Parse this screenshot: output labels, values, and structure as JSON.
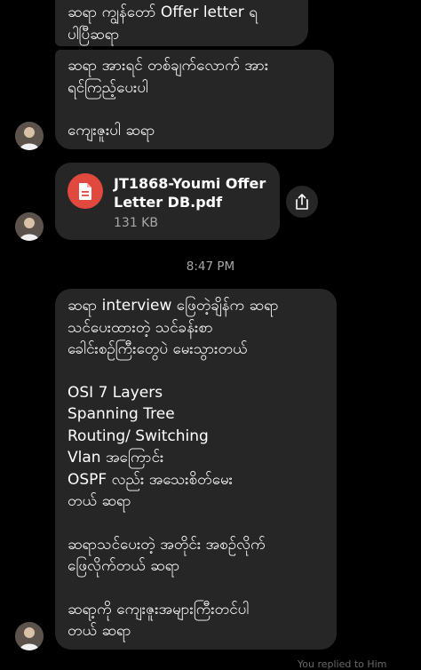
{
  "messages": {
    "bubble_1": {
      "line_1": "ဆရာ ကျွန်တော် Offer letter ရ",
      "line_2": "ပါပြီဆရာ"
    },
    "bubble_2": {
      "line_1": "ဆရာ အားရင် တစ်ချက်လောက် အား",
      "line_2": "ရင်ကြည့်ပေးပါ",
      "line_3": "ကျေးဇူးပါ ဆရာ"
    },
    "file": {
      "name": "JT1868-Youmi Offer Letter DB.pdf",
      "size": "131 KB",
      "icon": "document-icon",
      "icon_color": "#e2493e"
    },
    "timestamp": "8:47 PM",
    "bubble_3": {
      "intro_1": "ဆရာ interview ဖြေတဲ့ချိန်က ဆရာ",
      "intro_2": "သင်ပေးထားတဲ့ သင်ခန်းစာ",
      "intro_3": "ခေါင်းစဉ်ကြီးတွေပဲ မေးသွားတယ်",
      "topic_1": "OSI 7 Layers",
      "topic_2": "Spanning Tree",
      "topic_3": "Routing/ Switching",
      "topic_4": "Vlan အကြောင်း",
      "topic_5": "OSPF လည်း အသေးစိတ်မေး",
      "topic_6": "တယ် ဆရာ",
      "follow_1": "ဆရာသင်ပေးတဲ့ အတိုင်း အစဉ်လိုက်",
      "follow_2": "ဖြေလိုက်တယ် ဆရာ",
      "thanks_1": "ဆရာ့ကို ကျေးဇူးအများကြီးတင်ပါ",
      "thanks_2": "တယ် ဆရာ"
    },
    "footer": "You replied to Him"
  },
  "colors": {
    "background": "#000000",
    "bubble": "#262626",
    "secondary_text": "#a8a8a8",
    "file_icon": "#e2493e"
  }
}
